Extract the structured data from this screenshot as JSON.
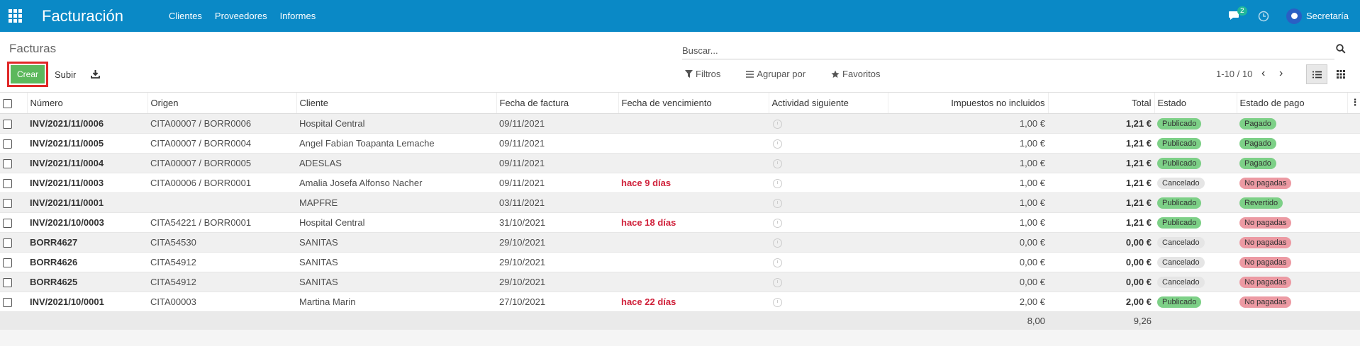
{
  "navbar": {
    "app_title": "Facturación",
    "menu": [
      "Clientes",
      "Proveedores",
      "Informes"
    ],
    "chat_count": "2",
    "user_name": "Secretaría"
  },
  "control": {
    "page_title": "Facturas",
    "search_placeholder": "Buscar...",
    "create_label": "Crear",
    "upload_label": "Subir",
    "filters_label": "Filtros",
    "group_label": "Agrupar por",
    "favorites_label": "Favoritos",
    "pager": "1-10 / 10"
  },
  "table": {
    "headers": [
      "Número",
      "Origen",
      "Cliente",
      "Fecha de factura",
      "Fecha de vencimiento",
      "Actividad siguiente",
      "Impuestos no incluidos",
      "Total",
      "Estado",
      "Estado de pago"
    ],
    "rows": [
      {
        "numero": "INV/2021/11/0006",
        "origen": "CITA00007 / BORR0006",
        "cliente": "Hospital Central",
        "fecha": "09/11/2021",
        "vencimiento": "",
        "impuestos": "1,00 €",
        "total": "1,21 €",
        "estado": "Publicado",
        "pago": "Pagado"
      },
      {
        "numero": "INV/2021/11/0005",
        "origen": "CITA00007 / BORR0004",
        "cliente": "Angel Fabian Toapanta Lemache",
        "fecha": "09/11/2021",
        "vencimiento": "",
        "impuestos": "1,00 €",
        "total": "1,21 €",
        "estado": "Publicado",
        "pago": "Pagado"
      },
      {
        "numero": "INV/2021/11/0004",
        "origen": "CITA00007 / BORR0005",
        "cliente": "ADESLAS",
        "fecha": "09/11/2021",
        "vencimiento": "",
        "impuestos": "1,00 €",
        "total": "1,21 €",
        "estado": "Publicado",
        "pago": "Pagado"
      },
      {
        "numero": "INV/2021/11/0003",
        "origen": "CITA00006 / BORR0001",
        "cliente": "Amalia Josefa Alfonso Nacher",
        "fecha": "09/11/2021",
        "vencimiento": "hace 9 días",
        "impuestos": "1,00 €",
        "total": "1,21 €",
        "estado": "Cancelado",
        "pago": "No pagadas"
      },
      {
        "numero": "INV/2021/11/0001",
        "origen": "",
        "cliente": "MAPFRE",
        "fecha": "03/11/2021",
        "vencimiento": "",
        "impuestos": "1,00 €",
        "total": "1,21 €",
        "estado": "Publicado",
        "pago": "Revertido"
      },
      {
        "numero": "INV/2021/10/0003",
        "origen": "CITA54221 / BORR0001",
        "cliente": "Hospital Central",
        "fecha": "31/10/2021",
        "vencimiento": "hace 18 días",
        "impuestos": "1,00 €",
        "total": "1,21 €",
        "estado": "Publicado",
        "pago": "No pagadas"
      },
      {
        "numero": "BORR4627",
        "origen": "CITA54530",
        "cliente": "SANITAS",
        "fecha": "29/10/2021",
        "vencimiento": "",
        "impuestos": "0,00 €",
        "total": "0,00 €",
        "estado": "Cancelado",
        "pago": "No pagadas"
      },
      {
        "numero": "BORR4626",
        "origen": "CITA54912",
        "cliente": "SANITAS",
        "fecha": "29/10/2021",
        "vencimiento": "",
        "impuestos": "0,00 €",
        "total": "0,00 €",
        "estado": "Cancelado",
        "pago": "No pagadas"
      },
      {
        "numero": "BORR4625",
        "origen": "CITA54912",
        "cliente": "SANITAS",
        "fecha": "29/10/2021",
        "vencimiento": "",
        "impuestos": "0,00 €",
        "total": "0,00 €",
        "estado": "Cancelado",
        "pago": "No pagadas"
      },
      {
        "numero": "INV/2021/10/0001",
        "origen": "CITA00003",
        "cliente": "Martina Marin",
        "fecha": "27/10/2021",
        "vencimiento": "hace 22 días",
        "impuestos": "2,00 €",
        "total": "2,00 €",
        "estado": "Publicado",
        "pago": "No pagadas"
      }
    ],
    "footer": {
      "impuestos_sum": "8,00",
      "total_sum": "9,26"
    }
  },
  "colors": {
    "navbar": "#0a89c6",
    "create_button": "#5cb85c",
    "overdue": "#d0213b",
    "tag_green": "#7dd087",
    "tag_grey": "#e5e5e5",
    "tag_red": "#ec9aa3"
  }
}
